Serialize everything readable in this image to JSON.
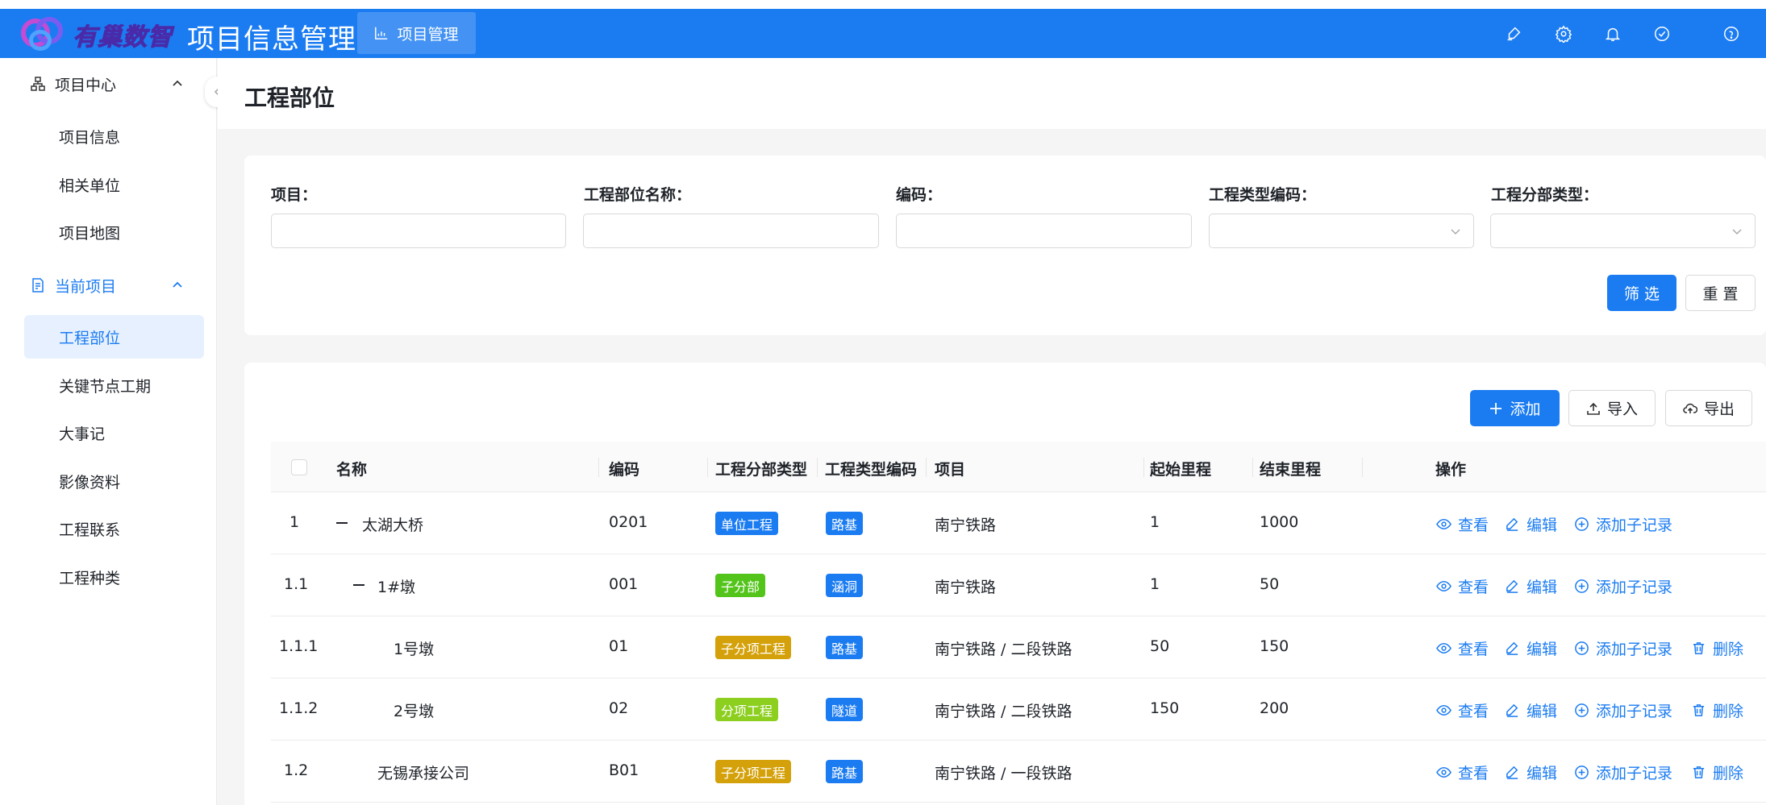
{
  "header": {
    "logo_text": "有巢数智",
    "app_title": "项目信息管理",
    "nav_tab": "项目管理",
    "icons": [
      "brush-icon",
      "gear-icon",
      "bell-icon",
      "check-circle-icon",
      "help-icon"
    ],
    "bg_color": "#1b7cf2"
  },
  "sidebar": {
    "group1": {
      "label": "项目中心",
      "items": [
        "项目信息",
        "相关单位",
        "项目地图"
      ]
    },
    "group2": {
      "label": "当前项目",
      "items": [
        "工程部位",
        "关键节点工期",
        "大事记",
        "影像资料",
        "工程联系",
        "工程种类"
      ]
    },
    "active_item": "工程部位"
  },
  "page": {
    "title": "工程部位"
  },
  "filters": {
    "project_label": "项目：",
    "name_label": "工程部位名称：",
    "code_label": "编码：",
    "type_code_label": "工程类型编码：",
    "division_type_label": "工程分部类型：",
    "filter_button": "筛 选",
    "reset_button": "重 置"
  },
  "toolbar": {
    "add": "添加",
    "import": "导入",
    "export": "导出"
  },
  "table": {
    "columns": [
      "名称",
      "编码",
      "工程分部类型",
      "工程类型编码",
      "项目",
      "起始里程",
      "结束里程",
      "操作"
    ],
    "actions": {
      "view": "查看",
      "edit": "编辑",
      "add_child": "添加子记录",
      "delete": "删除"
    },
    "rows": [
      {
        "index": "1",
        "name": "太湖大桥",
        "code": "0201",
        "div_type": "单位工程",
        "div_color": "#1b7cf2",
        "type_code": "路基",
        "project": "南宁铁路",
        "start": "1",
        "end": "1000",
        "expand": true,
        "indent": 0,
        "can_delete": false
      },
      {
        "index": "1.1",
        "name": "1#墩",
        "code": "001",
        "div_type": "子分部",
        "div_color": "#52c41a",
        "type_code": "涵洞",
        "project": "南宁铁路",
        "start": "1",
        "end": "50",
        "expand": true,
        "indent": 1,
        "can_delete": false
      },
      {
        "index": "1.1.1",
        "name": "1号墩",
        "code": "01",
        "div_type": "子分项工程",
        "div_color": "#d4a10a",
        "type_code": "路基",
        "project": "南宁铁路 / 二段铁路",
        "start": "50",
        "end": "150",
        "expand": false,
        "indent": 2,
        "can_delete": true
      },
      {
        "index": "1.1.2",
        "name": "2号墩",
        "code": "02",
        "div_type": "分项工程",
        "div_color": "#8ccf1f",
        "type_code": "隧道",
        "project": "南宁铁路 / 二段铁路",
        "start": "150",
        "end": "200",
        "expand": false,
        "indent": 2,
        "can_delete": true
      },
      {
        "index": "1.2",
        "name": "无锡承接公司",
        "code": "B01",
        "div_type": "子分项工程",
        "div_color": "#d4a10a",
        "type_code": "路基",
        "project": "南宁铁路 / 一段铁路",
        "start": "",
        "end": "",
        "expand": false,
        "indent": 1,
        "can_delete": true
      }
    ]
  }
}
